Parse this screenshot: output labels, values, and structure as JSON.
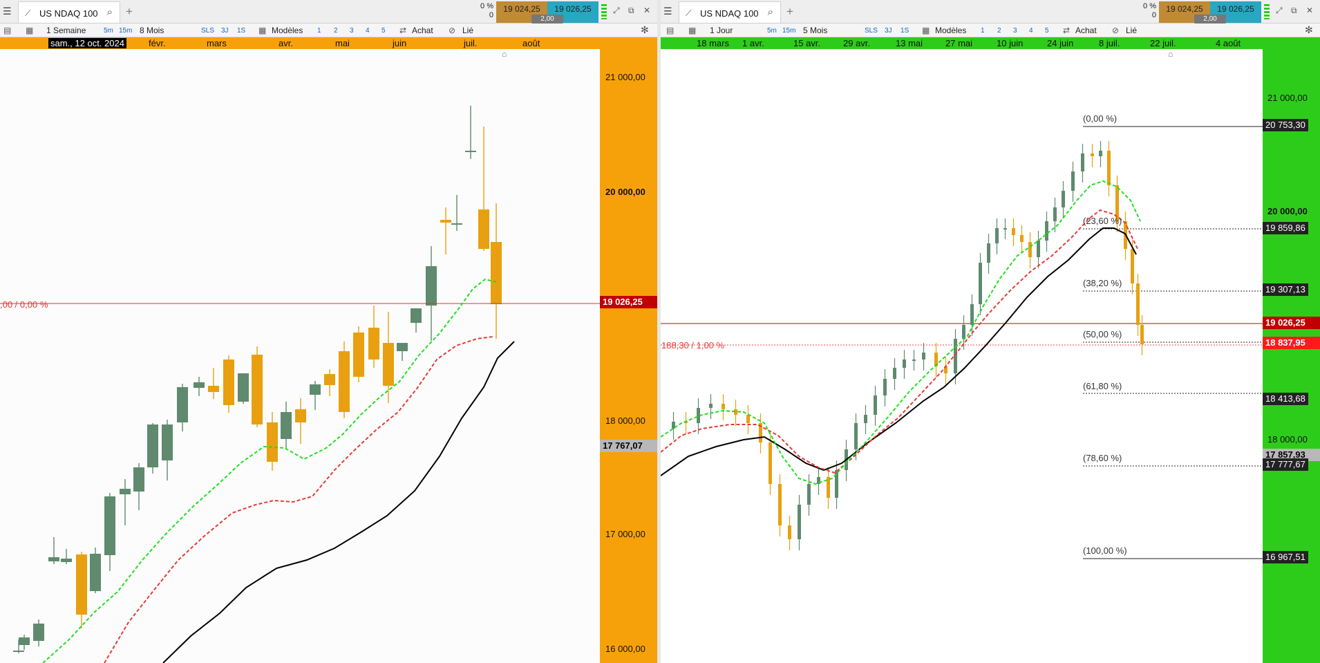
{
  "colors": {
    "bull": "#5f8a6e",
    "bear": "#e8a010",
    "left_accent": "#f7a10a",
    "right_accent": "#2ecc1a",
    "price_red": "#c00000"
  },
  "left": {
    "tab_title": "US NDAQ 100",
    "pct_change": "0 %",
    "pct_points": "0",
    "bid": "19 024,25",
    "ask": "19 026,25",
    "spread": "2,00",
    "toolbar": {
      "interval": "1 Semaine",
      "m5": "5m",
      "m15": "15m",
      "range": "8 Mois",
      "sls": "SLS",
      "j3": "3J",
      "s1": "1S",
      "models": "Modèles",
      "n1": "1",
      "n2": "2",
      "n3": "3",
      "n4": "4",
      "n5": "5",
      "buy": "Achat",
      "linked": "Lié"
    },
    "current_date": "sam., 12 oct. 2024",
    "time_labels": [
      "févr.",
      "mars",
      "avr.",
      "mai",
      "juin",
      "juil.",
      "août"
    ],
    "y_ticks": [
      "21 000,00",
      "20 000,00",
      "18 000,00",
      "17 000,00",
      "16 000,00"
    ],
    "price_label": "19 026,25",
    "ma_label": "17 767,07",
    "line_label": ",00 / 0,00 %"
  },
  "right": {
    "tab_title": "US NDAQ 100",
    "pct_change": "0 %",
    "pct_points": "0",
    "bid": "19 024,25",
    "ask": "19 026,25",
    "spread": "2,00",
    "toolbar": {
      "interval": "1 Jour",
      "m5": "5m",
      "m15": "15m",
      "range": "5 Mois",
      "sls": "SLS",
      "j3": "3J",
      "s1": "1S",
      "models": "Modèles",
      "n1": "1",
      "n2": "2",
      "n3": "3",
      "n4": "4",
      "n5": "5",
      "buy": "Achat",
      "linked": "Lié"
    },
    "time_labels": [
      "18 mars",
      "1 avr.",
      "15 avr.",
      "29 avr.",
      "13 mai",
      "27 mai",
      "10 juin",
      "24 juin",
      "8 juil.",
      "22 juil.",
      "4 août"
    ],
    "y_ticks": [
      "21 000,00",
      "20 000,00",
      "18 000,00"
    ],
    "fib_levels": [
      {
        "label": "(0,00 %)",
        "price": "20 753,30"
      },
      {
        "label": "(23,60 %)",
        "price": "19 859,86"
      },
      {
        "label": "(38,20 %)",
        "price": "19 307,13"
      },
      {
        "label": "(50,00 %)",
        "price": ""
      },
      {
        "label": "(61,80 %)",
        "price": "18 413,68"
      },
      {
        "label": "(78,60 %)",
        "price": "17 777,67"
      },
      {
        "label": "(100,00 %)",
        "price": "16 967,51"
      }
    ],
    "price_label": "19 026,25",
    "alert_label": "18 837,95",
    "ma_label": "17 857,93",
    "alert_line_label": "188,30 / 1,00 %"
  }
}
